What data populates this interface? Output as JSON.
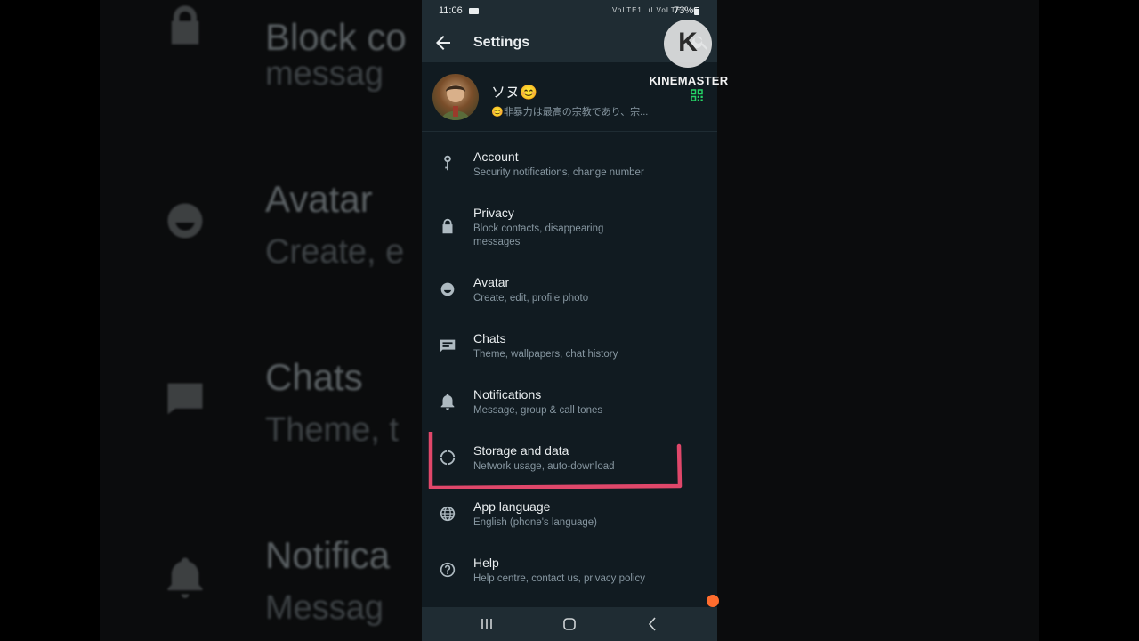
{
  "status_bar": {
    "time": "11:06",
    "network": "VoLTE1 .ıl VoLTE2 .ıl",
    "battery": "73%"
  },
  "app_bar": {
    "title": "Settings"
  },
  "profile": {
    "name": "ソヌ😊",
    "about": "😊非暴力は最高の宗教であり、宗..."
  },
  "settings_items": [
    {
      "label": "Account",
      "description": "Security notifications, change number",
      "icon": "key-icon"
    },
    {
      "label": "Privacy",
      "description": "Block contacts, disappearing messages",
      "icon": "lock-icon"
    },
    {
      "label": "Avatar",
      "description": "Create, edit, profile photo",
      "icon": "avatar-icon"
    },
    {
      "label": "Chats",
      "description": "Theme, wallpapers, chat history",
      "icon": "chat-icon"
    },
    {
      "label": "Notifications",
      "description": "Message, group & call tones",
      "icon": "bell-icon"
    },
    {
      "label": "Storage and data",
      "description": "Network usage, auto-download",
      "icon": "storage-circle-icon"
    },
    {
      "label": "App language",
      "description": "English (phone's language)",
      "icon": "globe-icon"
    },
    {
      "label": "Help",
      "description": "Help centre, contact us, privacy policy",
      "icon": "help-icon"
    }
  ],
  "background_text": {
    "block": "Block co",
    "block_sub": "messag",
    "avatar": "Avatar",
    "avatar_sub": "Create, e",
    "chats": "Chats",
    "chats_sub": "Theme, t",
    "notifications": "Notifica",
    "notifications_sub": "Messag"
  },
  "watermark": {
    "logo_letter": "K",
    "text": "KINEMASTER"
  },
  "colors": {
    "accent_green": "#25d366",
    "highlight_red": "#e0476a",
    "panel": "#111b21",
    "bar": "#1f2c33"
  }
}
